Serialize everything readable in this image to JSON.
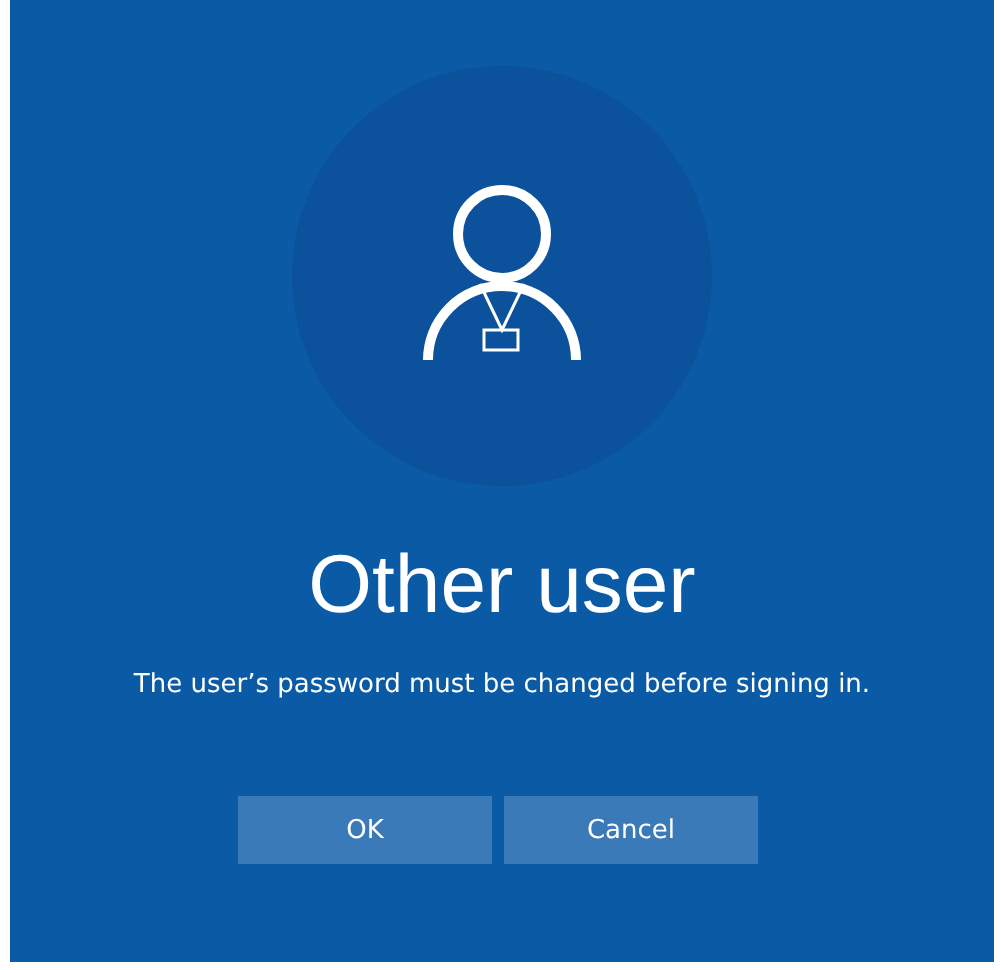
{
  "title": "Other user",
  "message": "The user’s password must be changed before signing in.",
  "buttons": [
    "OK",
    "Cancel"
  ]
}
